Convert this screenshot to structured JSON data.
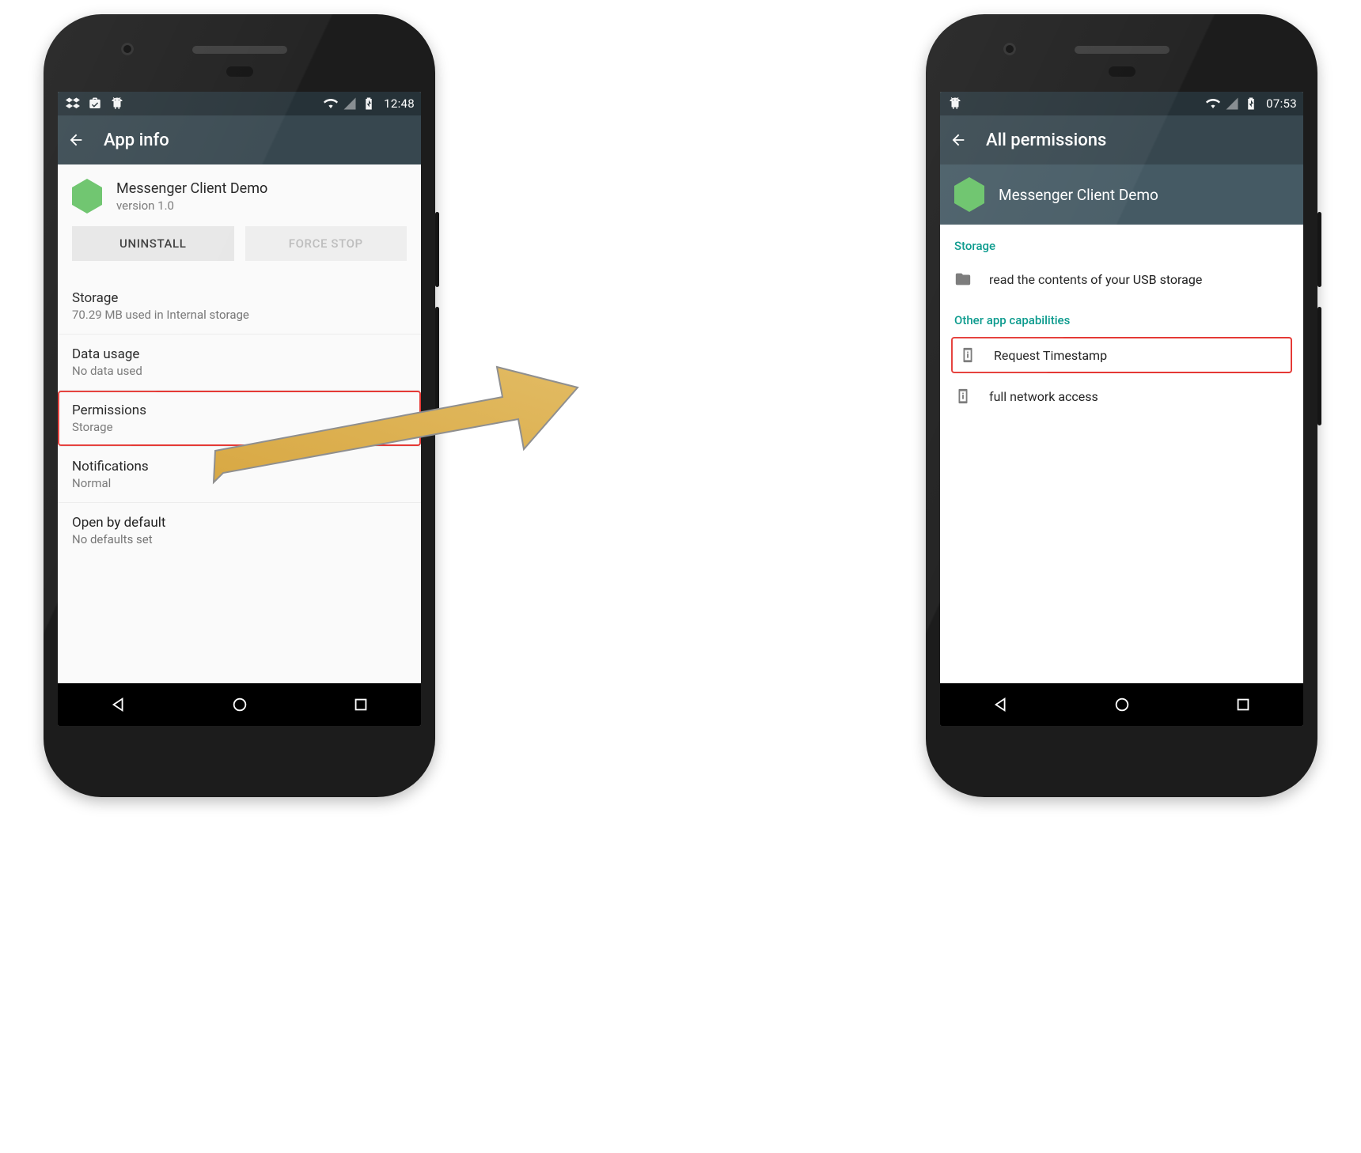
{
  "phoneA": {
    "status": {
      "time": "12:48",
      "notif_icons": [
        "dropbox-icon",
        "briefcase-check-icon",
        "android-icon"
      ],
      "sys_icons": [
        "wifi-icon",
        "cell-icon",
        "battery-charge-icon"
      ]
    },
    "title": "App info",
    "app": {
      "name": "Messenger Client Demo",
      "version": "version 1.0"
    },
    "buttons": {
      "uninstall": "UNINSTALL",
      "force_stop": "FORCE STOP"
    },
    "items": [
      {
        "title": "Storage",
        "sub": "70.29 MB used in Internal storage"
      },
      {
        "title": "Data usage",
        "sub": "No data used"
      },
      {
        "title": "Permissions",
        "sub": "Storage"
      },
      {
        "title": "Notifications",
        "sub": "Normal"
      },
      {
        "title": "Open by default",
        "sub": "No defaults set"
      }
    ]
  },
  "phoneB": {
    "status": {
      "time": "07:53",
      "notif_icons": [
        "android-icon"
      ],
      "sys_icons": [
        "wifi-icon",
        "cell-icon",
        "battery-charge-icon"
      ]
    },
    "title": "All permissions",
    "app": {
      "name": "Messenger Client Demo"
    },
    "sections": {
      "storage": {
        "label": "Storage",
        "items": [
          "read the contents of your USB storage"
        ]
      },
      "other": {
        "label": "Other app capabilities",
        "items": [
          "Request Timestamp",
          "full network access"
        ]
      }
    }
  },
  "colors": {
    "accent": "#009688",
    "appbar": "#37474f",
    "status": "#263238",
    "subbar": "#455a64",
    "highlight": "#e53935",
    "arrow": "#dcb04a"
  }
}
